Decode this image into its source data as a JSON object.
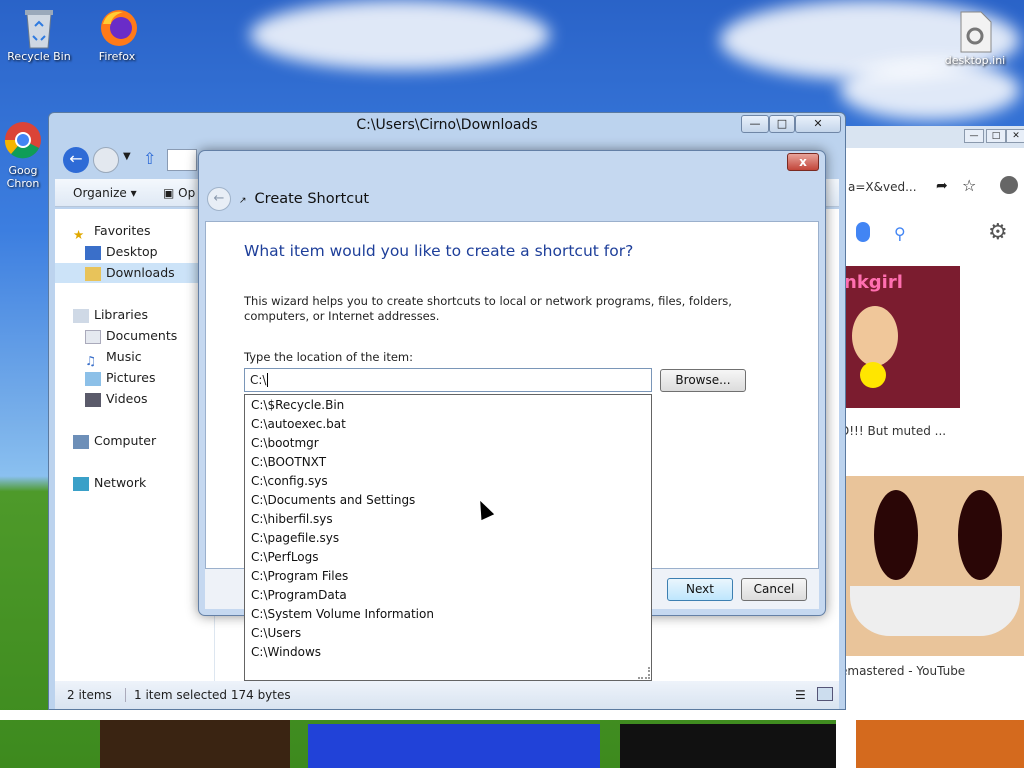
{
  "desktop": {
    "icons": [
      {
        "label": "Recycle Bin"
      },
      {
        "label": "Firefox"
      },
      {
        "label": "Goog\nChron"
      },
      {
        "label": "desktop.ini"
      }
    ]
  },
  "chrome": {
    "address_fragment": "a=X&ved...",
    "result1_caption": "D!!! But muted ...",
    "result1_image_text": "nkgirl",
    "result2_caption": "emastered - YouTube"
  },
  "explorer": {
    "title": "C:\\Users\\Cirno\\Downloads",
    "toolbar": {
      "organize": "Organize",
      "open": "Op"
    },
    "nav": {
      "favorites": "Favorites",
      "desktop": "Desktop",
      "downloads": "Downloads",
      "libraries": "Libraries",
      "documents": "Documents",
      "music": "Music",
      "pictures": "Pictures",
      "videos": "Videos",
      "computer": "Computer",
      "network": "Network"
    },
    "status": {
      "items": "2 items",
      "selected": "1 item selected  174 bytes"
    }
  },
  "dialog": {
    "title": "Create Shortcut",
    "question": "What item would you like to create a shortcut for?",
    "description": "This wizard helps you to create shortcuts to local or network programs, files, folders, computers, or Internet addresses.",
    "location_label": "Type the location of the item:",
    "location_value": "C:\\",
    "browse": "Browse...",
    "next": "Next",
    "cancel": "Cancel",
    "close": "x"
  },
  "autocomplete": [
    "C:\\$Recycle.Bin",
    "C:\\autoexec.bat",
    "C:\\bootmgr",
    "C:\\BOOTNXT",
    "C:\\config.sys",
    "C:\\Documents and Settings",
    "C:\\hiberfil.sys",
    "C:\\pagefile.sys",
    "C:\\PerfLogs",
    "C:\\Program Files",
    "C:\\ProgramData",
    "C:\\System Volume Information",
    "C:\\Users",
    "C:\\Windows"
  ],
  "colors": {
    "accent": "#1e3f9a",
    "selection": "#cce3f8",
    "close": "#c2463a"
  }
}
